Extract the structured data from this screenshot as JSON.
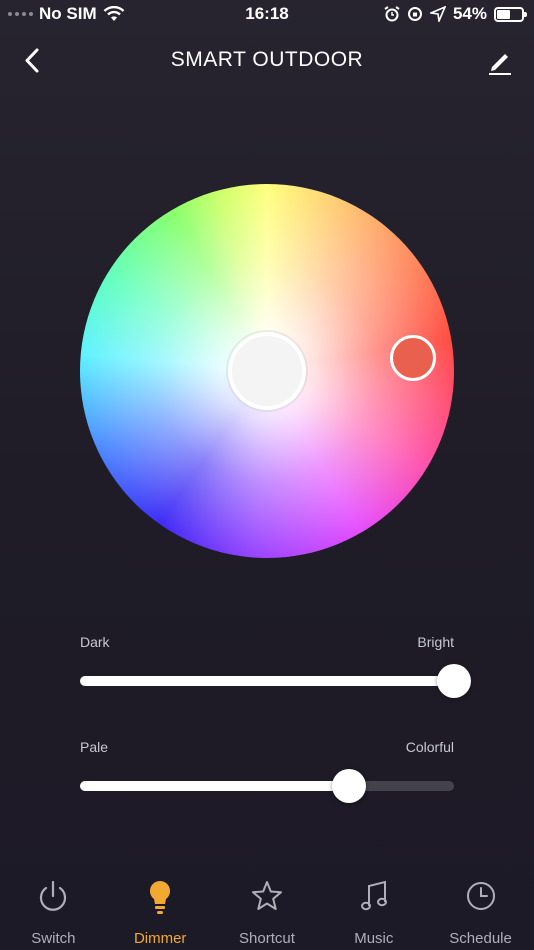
{
  "status_bar": {
    "carrier": "No SIM",
    "time": "16:18",
    "battery": "54%",
    "battery_level": 0.54
  },
  "header": {
    "title": "SMART OUTDOOR"
  },
  "icons": {
    "back": "chevron-left-icon",
    "edit": "pencil-icon"
  },
  "color_wheel": {
    "selected_color": "#e9604f"
  },
  "brightness": {
    "min_label": "Dark",
    "max_label": "Bright",
    "value": 1.0
  },
  "saturation": {
    "min_label": "Pale",
    "max_label": "Colorful",
    "value": 0.72
  },
  "tabs": [
    {
      "label": "Switch",
      "icon": "power-icon",
      "active": false
    },
    {
      "label": "Dimmer",
      "icon": "bulb-icon",
      "active": true
    },
    {
      "label": "Shortcut",
      "icon": "star-icon",
      "active": false
    },
    {
      "label": "Music",
      "icon": "music-note-icon",
      "active": false
    },
    {
      "label": "Schedule",
      "icon": "clock-icon",
      "active": false
    }
  ],
  "colors": {
    "accent": "#f3a832",
    "inactive": "#b0aeb8",
    "background": "#211e29"
  }
}
